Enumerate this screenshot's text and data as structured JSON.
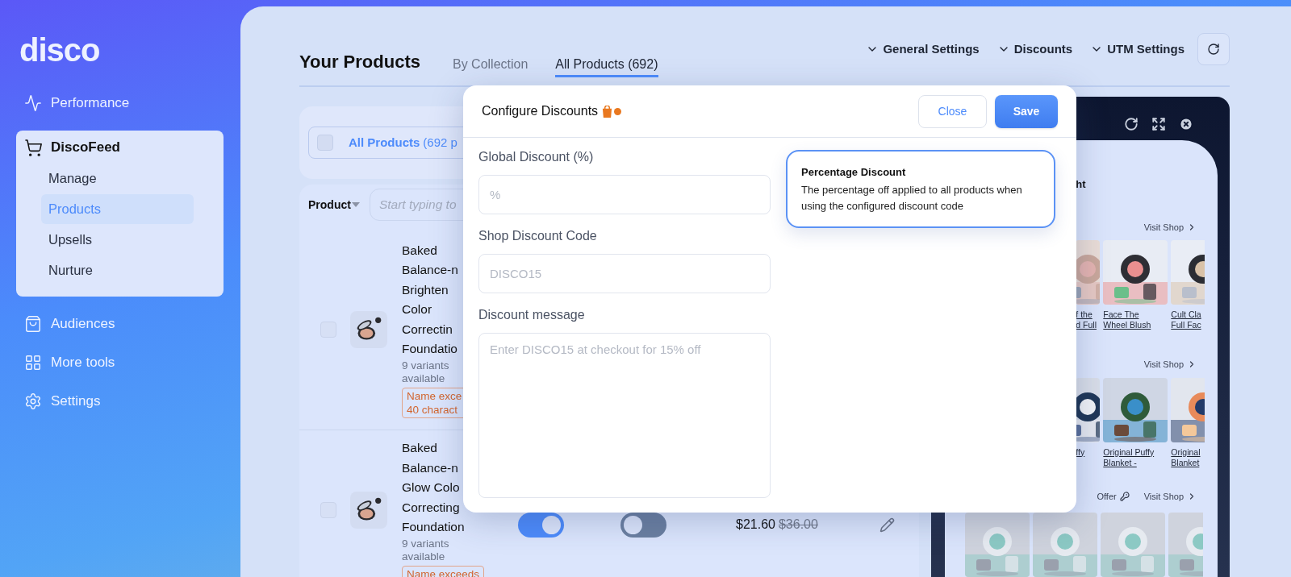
{
  "logo": "disco",
  "sidebar": {
    "items": [
      {
        "label": "Performance",
        "selected": false
      },
      {
        "label": "DiscoFeed",
        "selected": false,
        "expanded": true,
        "children": [
          {
            "label": "Manage",
            "selected": false
          },
          {
            "label": "Products",
            "selected": true
          },
          {
            "label": "Upsells",
            "selected": false
          },
          {
            "label": "Nurture",
            "selected": false
          }
        ]
      },
      {
        "label": "Audiences",
        "selected": false
      },
      {
        "label": "More tools",
        "selected": false
      },
      {
        "label": "Settings",
        "selected": false
      }
    ]
  },
  "header": {
    "title": "Your Products",
    "tabs": [
      {
        "label": "By Collection",
        "selected": false
      },
      {
        "label": "All Products (692)",
        "selected": true
      }
    ],
    "menus": [
      {
        "label": "General Settings"
      },
      {
        "label": "Discounts"
      },
      {
        "label": "UTM Settings"
      }
    ]
  },
  "filter": {
    "label": "All Products",
    "count": "(692 p",
    "checked": false
  },
  "search": {
    "column": "Product",
    "placeholder": "Start typing to"
  },
  "products": [
    {
      "checked": false,
      "name_lines": [
        "Baked",
        "Balance-n",
        "Brighten",
        "Color",
        "Correctin",
        "Foundatio"
      ],
      "variants": "9 variants available",
      "warning_lines": [
        "Name exce",
        "40 charact"
      ]
    },
    {
      "checked": false,
      "name_lines": [
        "Baked",
        "Balance-n",
        "Glow Colo",
        "Correcting",
        "Foundation"
      ],
      "variants": "9 variants available",
      "warning_lines": [
        "Name exceeds"
      ],
      "toggles": [
        {
          "on": true
        },
        {
          "on": false
        }
      ],
      "price": "$21.60",
      "original_price": "$36.00"
    }
  ],
  "modal": {
    "title": "Configure Discounts",
    "buttons": [
      {
        "label": "Close",
        "kind": "secondary"
      },
      {
        "label": "Save",
        "kind": "primary"
      }
    ],
    "fields": [
      {
        "label": "Global Discount (%)",
        "placeholder": "%",
        "kind": "input"
      },
      {
        "label": "Shop Discount Code",
        "placeholder": "DISCO15",
        "kind": "input"
      },
      {
        "label": "Discount message",
        "placeholder": "Enter DISCO15 at checkout for 15% off",
        "kind": "textarea"
      }
    ],
    "tooltip": {
      "title": "Percentage Discount",
      "text": "The percentage off applied to all products when using the configured discount code"
    }
  },
  "preview": {
    "heading": "ht",
    "sections": [
      {
        "link": "Visit Shop",
        "products": [
          {
            "lines": [
              "f the",
              "d Full"
            ]
          },
          {
            "lines": [
              "Face The",
              "Wheel Blush"
            ]
          },
          {
            "lines": [
              "Cult Cla",
              "Full Fac"
            ]
          }
        ]
      },
      {
        "link": "Visit Shop",
        "products": [
          {
            "lines": [
              "ffy"
            ]
          },
          {
            "lines": [
              "Original Puffy",
              "Blanket -"
            ]
          },
          {
            "lines": [
              "Original",
              "Blanket"
            ]
          }
        ]
      }
    ],
    "offer": {
      "label": "Offer",
      "link": "Visit Shop"
    }
  }
}
